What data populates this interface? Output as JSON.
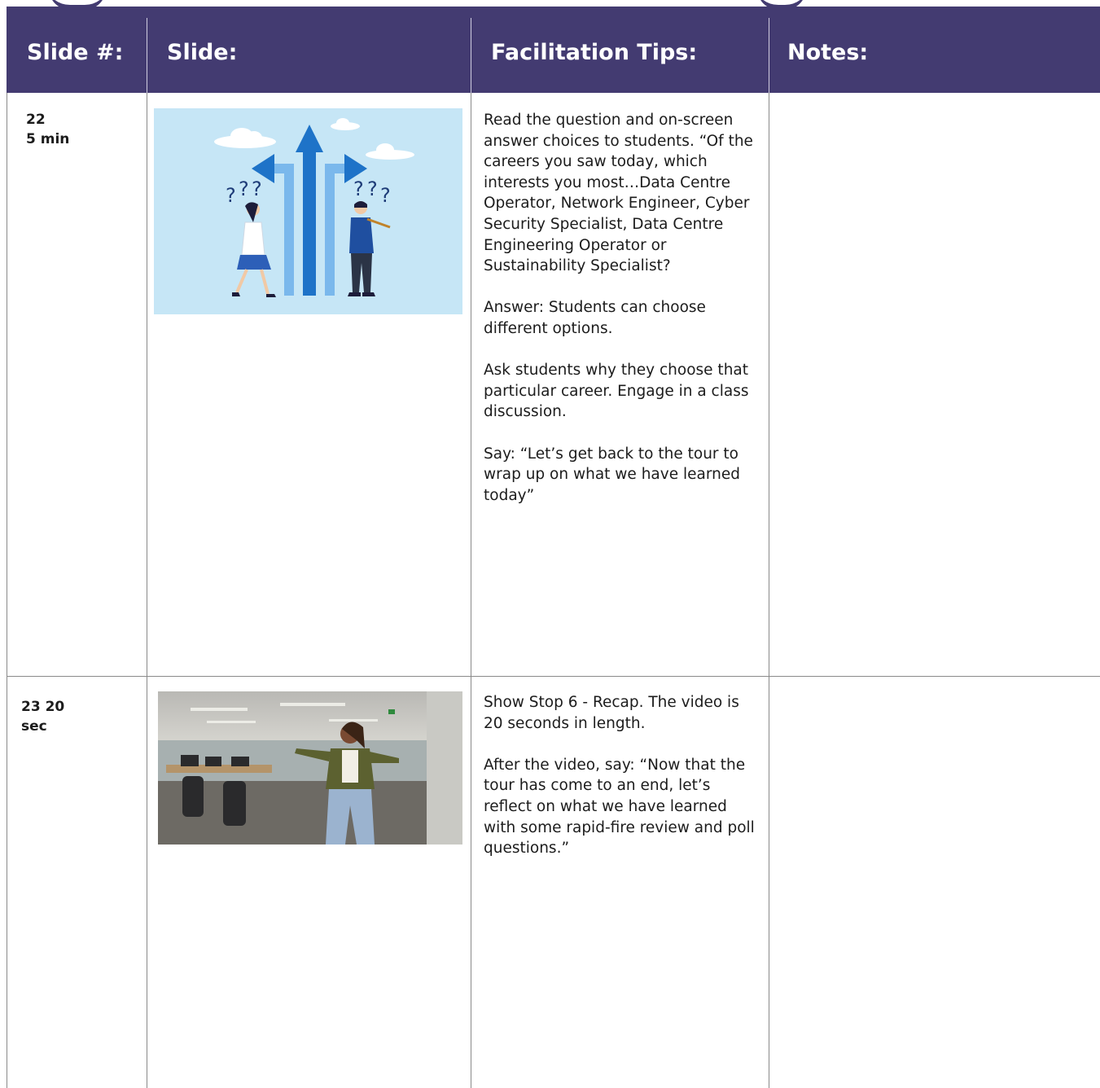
{
  "table": {
    "headers": {
      "slide_num": "Slide #:",
      "slide": "Slide:",
      "facilitation_tips": "Facilitation Tips:",
      "notes": "Notes:"
    },
    "rows": [
      {
        "slide_num": "22\n5 min",
        "tips": [
          "Read the question and on-screen answer choices to students. “Of the careers you saw today, which interests you most…Data Centre Operator, Network Engineer, Cyber Security Specialist, Data Centre Engineering Operator or Sustainability Specialist?",
          "Answer: Students can choose different options.",
          "Ask students why they choose that particular career. Engage in a class discussion.",
          "Say: “Let’s get back to the tour to wrap up on what we have learned today”"
        ],
        "notes": ""
      },
      {
        "slide_num": "23 20\nsec",
        "tips": [
          "Show Stop 6 - Recap. The video is 20 seconds in length.",
          "After the video, say: “Now that the tour has come to an end, let’s reflect on what we have learned with some rapid-fire review and poll questions.”"
        ],
        "notes": ""
      }
    ]
  },
  "colors": {
    "header_bg": "#433b71",
    "header_text": "#ffffff",
    "illustration_bg": "#c6e6f6",
    "arrow_blue": "#1e73c8"
  }
}
